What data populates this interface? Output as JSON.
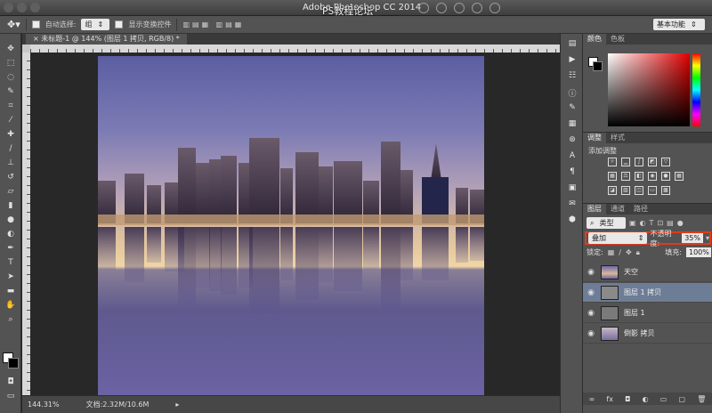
{
  "app": {
    "title": "Adobe Photoshop CC 2014",
    "watermark": "PS教程论坛\nBBS.16XX8.COM",
    "workspace": "基本功能"
  },
  "options_bar": {
    "auto_select_label": "自动选择:",
    "auto_select_value": "组",
    "show_transform_label": "显示变换控件"
  },
  "document": {
    "tab_label": "未标题-1 @ 144% (图层 1 拷贝, RGB/8) *",
    "zoom": "144.31%",
    "doc_size": "文档:2.32M/10.6M"
  },
  "tools": [
    "move-icon",
    "marquee-icon",
    "lasso-icon",
    "quick-select-icon",
    "crop-icon",
    "eyedropper-icon",
    "heal-icon",
    "brush-icon",
    "stamp-icon",
    "history-brush-icon",
    "eraser-icon",
    "gradient-icon",
    "blur-icon",
    "dodge-icon",
    "pen-icon",
    "type-icon",
    "path-select-icon",
    "shape-icon",
    "hand-icon",
    "zoom-icon"
  ],
  "color_panel": {
    "tabs": [
      "颜色",
      "色板"
    ]
  },
  "adjustments_panel": {
    "tabs": [
      "调整",
      "样式"
    ],
    "title": "添加调整"
  },
  "layers_panel": {
    "tabs": [
      "图层",
      "通道",
      "路径"
    ],
    "filter_kind": "类型",
    "blend_mode": "叠加",
    "opacity_label": "不透明度:",
    "opacity_value": "35%",
    "lock_label": "锁定:",
    "fill_label": "填充:",
    "fill_value": "100%",
    "layers": [
      {
        "name": "天空",
        "selected": false
      },
      {
        "name": "图层 1 拷贝",
        "selected": true
      },
      {
        "name": "图层 1",
        "selected": false
      },
      {
        "name": "倒影 拷贝",
        "selected": false
      }
    ],
    "footer_icons": [
      "link-icon",
      "fx-icon",
      "mask-icon",
      "adjustment-layer-icon",
      "group-icon",
      "new-layer-icon",
      "trash-icon"
    ]
  },
  "colors": {
    "accent_highlight": "#e23a1a",
    "selected_layer": "#6d7d96"
  }
}
